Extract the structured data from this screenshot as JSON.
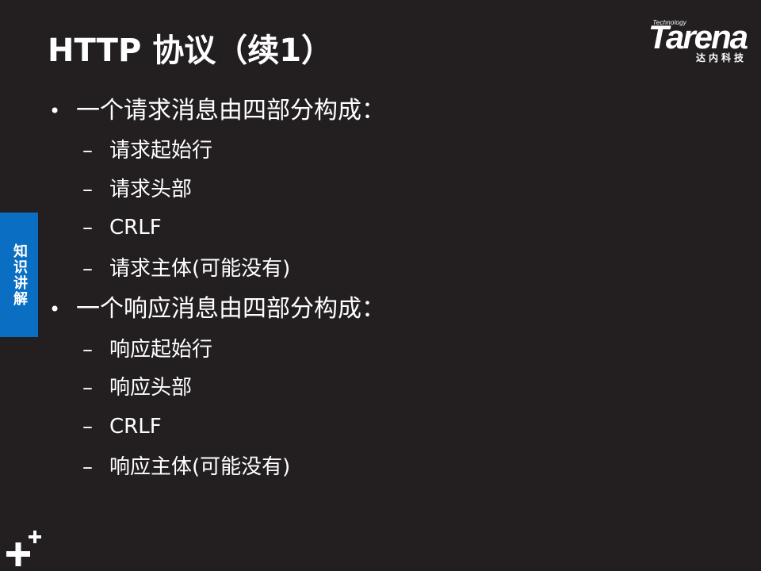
{
  "slide": {
    "title": "HTTP 协议（续1）"
  },
  "logo": {
    "small_text": "Technology",
    "main_text": "Tarena",
    "cn_text": "达内科技"
  },
  "side_tab": {
    "label": "知识讲解"
  },
  "bullet_glyph": "•",
  "dash_glyph": "–",
  "bullets": [
    {
      "text": "一个请求消息由四部分构成：",
      "subs": [
        "请求起始行",
        "请求头部",
        "CRLF",
        "请求主体(可能没有)"
      ]
    },
    {
      "text": "一个响应消息由四部分构成：",
      "subs": [
        "响应起始行",
        "响应头部",
        "CRLF",
        "响应主体(可能没有)"
      ]
    }
  ],
  "colors": {
    "background": "#231f20",
    "text": "#ffffff",
    "side_tab": "#0a6fc2"
  }
}
